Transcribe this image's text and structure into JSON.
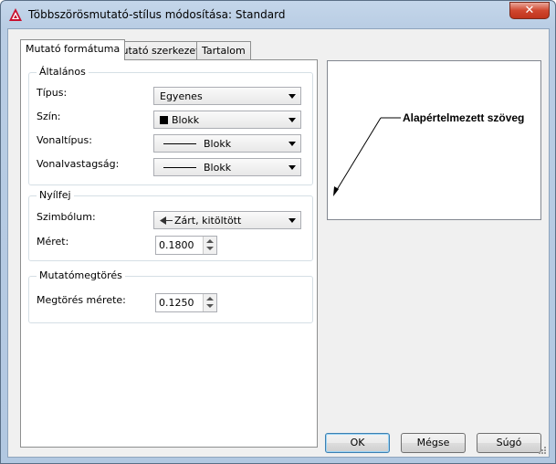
{
  "window": {
    "title": "Többszörösmutató-stílus módosítása: Standard",
    "close_glyph": "✕"
  },
  "tabs": [
    {
      "label": "Mutató formátuma",
      "active": true
    },
    {
      "label": "Mutató szerkezete",
      "active": false
    },
    {
      "label": "Tartalom",
      "active": false
    }
  ],
  "general": {
    "title": "Általános",
    "type_label": "Típus:",
    "type_value": "Egyenes",
    "color_label": "Szín:",
    "color_value": "Blokk",
    "linetype_label": "Vonaltípus:",
    "linetype_value": "Blokk",
    "lineweight_label": "Vonalvastagság:",
    "lineweight_value": "Blokk"
  },
  "arrowhead": {
    "title": "Nyílfej",
    "symbol_label": "Szimbólum:",
    "symbol_value": "Zárt, kitöltött",
    "size_label": "Méret:",
    "size_value": "0.1800"
  },
  "landing_break": {
    "title": "Mutatómegtörés",
    "break_size_label": "Megtörés mérete:",
    "break_size_value": "0.1250"
  },
  "preview": {
    "text": "Alapértelmezett szöveg"
  },
  "buttons": {
    "ok": "OK",
    "cancel": "Mégse",
    "help": "Súgó"
  },
  "colors": {
    "accent": "#3c7fb1",
    "app_icon": "#c8102e"
  }
}
